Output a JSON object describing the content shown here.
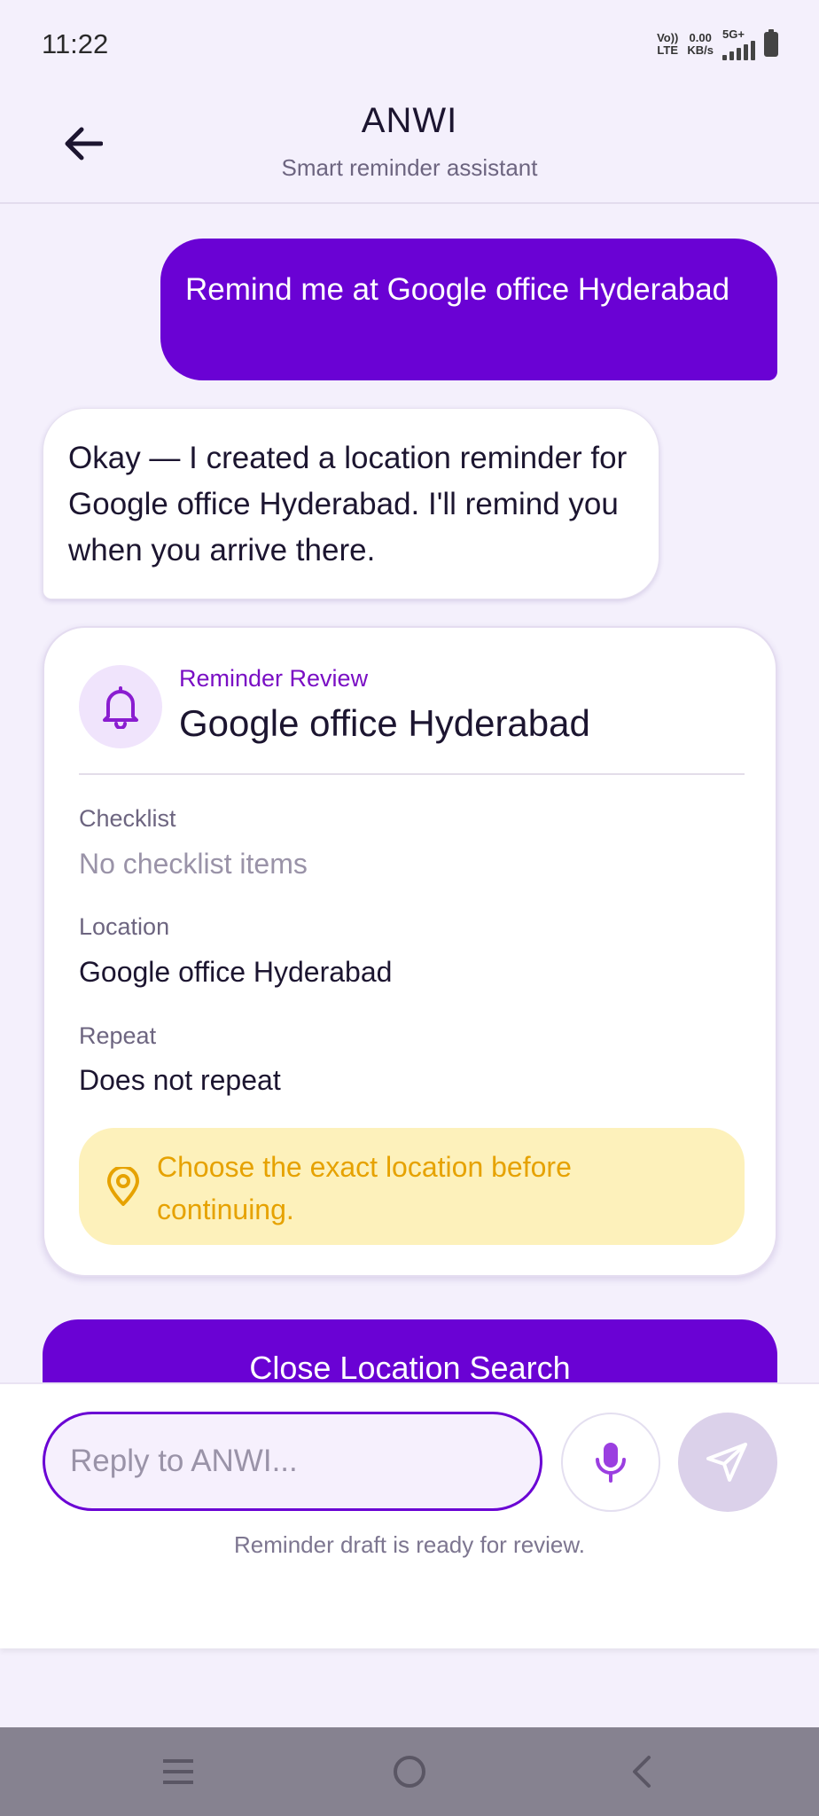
{
  "status_bar": {
    "time": "11:22",
    "volte_top": "Vo))",
    "volte_bottom": "LTE",
    "speed_value": "0.00",
    "speed_unit": "KB/s",
    "network": "5G+"
  },
  "header": {
    "title": "ANWI",
    "subtitle": "Smart reminder assistant"
  },
  "messages": {
    "user": "Remind me at Google office Hyderabad",
    "assistant": "Okay — I created a location reminder for Google office Hyderabad. I'll remind you when you arrive there."
  },
  "review": {
    "eyebrow": "Reminder Review",
    "title": "Google office Hyderabad",
    "checklist_label": "Checklist",
    "checklist_value": "No checklist items",
    "location_label": "Location",
    "location_value": "Google office Hyderabad",
    "repeat_label": "Repeat",
    "repeat_value": "Does not repeat",
    "warning": "Choose the exact location before continuing."
  },
  "actions": {
    "close_location_search": "Close Location Search"
  },
  "composer": {
    "placeholder": "Reply to ANWI...",
    "status": "Reminder draft is ready for review."
  },
  "colors": {
    "accent": "#6a02d4",
    "background": "#f4f0fc",
    "warning_bg": "#fdf1bb",
    "warning_text": "#e6a200"
  },
  "icons": [
    "back-arrow-icon",
    "bell-icon",
    "location-pin-icon",
    "microphone-icon",
    "send-icon",
    "menu-icon",
    "home-icon",
    "nav-back-icon"
  ]
}
